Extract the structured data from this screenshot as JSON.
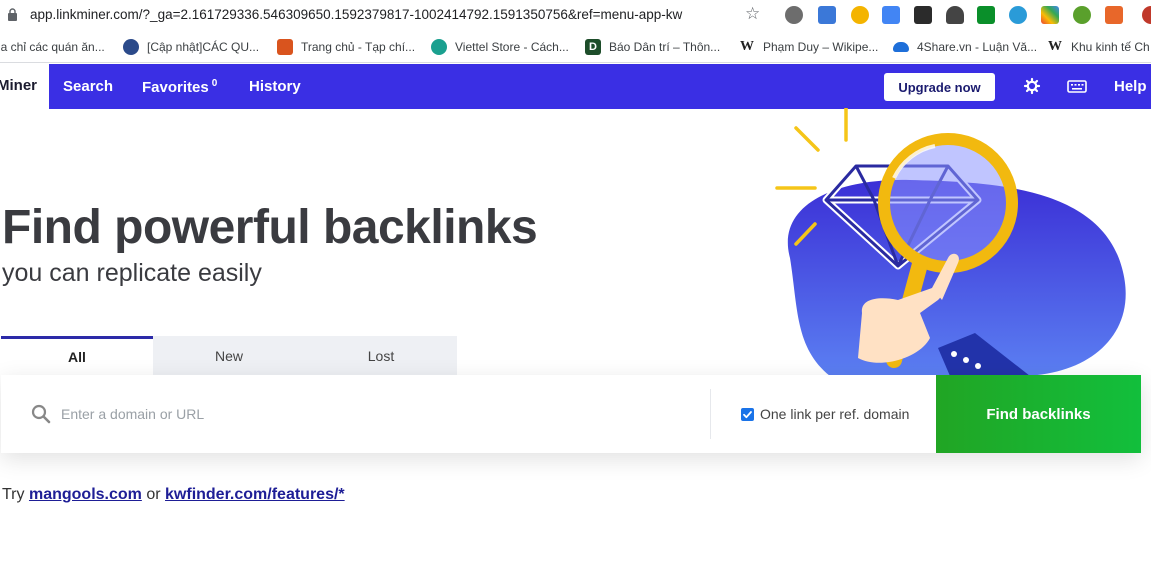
{
  "browser": {
    "url": "app.linkminer.com/?_ga=2.161729336.546309650.1592379817-1002414792.1591350756&ref=menu-app-kw",
    "bookmarks": [
      {
        "label": "ịa chỉ các quán ăn...",
        "icon": "none"
      },
      {
        "label": "[Cập nhật]CÁC QU...",
        "icon": "photo-icon"
      },
      {
        "label": "Trang chủ - Tạp chí...",
        "icon": "magazine-icon"
      },
      {
        "label": "Viettel Store - Cách...",
        "icon": "viettel-icon"
      },
      {
        "label": "Báo Dân trí – Thôn...",
        "icon": "dantri-icon"
      },
      {
        "label": "Phạm Duy – Wikipe...",
        "icon": "wikipedia-icon"
      },
      {
        "label": "4Share.vn - Luận Vă...",
        "icon": "cloud-icon"
      },
      {
        "label": "Khu kinh tế Ch",
        "icon": "wikipedia-icon"
      }
    ]
  },
  "nav": {
    "logo": "Miner",
    "search": "Search",
    "favorites": "Favorites",
    "favorites_count": "0",
    "history": "History",
    "upgrade": "Upgrade now",
    "help": "Help"
  },
  "hero": {
    "title": "Find powerful backlinks",
    "subtitle": "you can replicate easily"
  },
  "tabs": [
    {
      "label": "All",
      "active": true
    },
    {
      "label": "New",
      "active": false
    },
    {
      "label": "Lost",
      "active": false
    }
  ],
  "search": {
    "placeholder": "Enter a domain or URL",
    "value": "",
    "checkbox_label": "One link per ref. domain",
    "checkbox_checked": true,
    "button": "Find backlinks"
  },
  "footer": {
    "prefix": "Try",
    "link1": "mangools.com",
    "middle": "or",
    "link2": "kwfinder.com/features/*"
  },
  "colors": {
    "nav": "#3a2fe4",
    "button_green": "#17b331",
    "link": "#1e1e96",
    "title": "#3a3b40"
  }
}
